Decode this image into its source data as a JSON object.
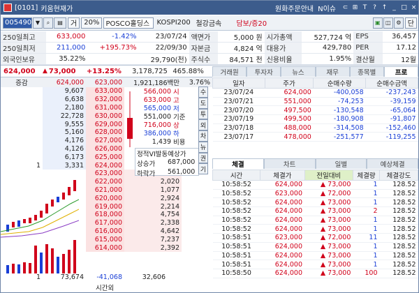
{
  "title": {
    "code": "[0101]",
    "name": "키움현재가",
    "right_label": "원화주문안내",
    "notice": "N이슈"
  },
  "toolbar": {
    "code": "005490",
    "type": "거",
    "pct": "20%",
    "stock": "POSCO홀딩스",
    "index": "KOSPI200",
    "sector": "철강금속",
    "margin": "담보/증20"
  },
  "info": {
    "rows": [
      {
        "l1": "250일최고",
        "v1": "633,000",
        "c1": "-1.42%",
        "d1": "23/07/24",
        "l2": "액면가",
        "v2": "5,000 원",
        "l3": "시가총액",
        "v3": "527,724 억",
        "l4": "EPS",
        "v4": "36,457"
      },
      {
        "l1": "250일최저",
        "v1": "211,000",
        "c1": "+195.73%",
        "d1": "22/09/30",
        "l2": "자본금",
        "v2": "4,824 억",
        "l3": "대용가",
        "v3": "429,780",
        "l4": "PER",
        "v4": "17.12"
      },
      {
        "l1": "외국인보유",
        "v1": "35.22%",
        "c1": "",
        "d1": "29,790(천)",
        "l2": "주식수",
        "v2": "84,571 천",
        "l3": "신용비율",
        "v3": "1.95%",
        "l4": "결산월",
        "v4": "12월"
      }
    ]
  },
  "price": {
    "current": "624,000",
    "change": "73,000",
    "rate": "+13.25%",
    "volume": "3,178,725",
    "ratio": "465.88%"
  },
  "orderbook_header": {
    "label": "증감",
    "sell_top": "624,000",
    "buy_top": "623,000",
    "total": "1,921,186백만",
    "pct": "3.76%"
  },
  "sells": [
    {
      "q": "9,607",
      "p": "633,000"
    },
    {
      "q": "6,638",
      "p": "632,000"
    },
    {
      "q": "2,180",
      "p": "631,000"
    },
    {
      "q": "22,728",
      "p": "630,000"
    },
    {
      "q": "9,555",
      "p": "629,000"
    },
    {
      "q": "5,160",
      "p": "628,000"
    },
    {
      "q": "4,176",
      "p": "627,000"
    },
    {
      "q": "4,126",
      "p": "626,000"
    },
    {
      "q": "6,173",
      "p": "625,000"
    },
    {
      "q": "3,331",
      "p": "624,000",
      "ch": "1"
    }
  ],
  "buys": [
    {
      "p": "623,000",
      "q": "3,008"
    },
    {
      "p": "622,000",
      "q": "2,020"
    },
    {
      "p": "621,000",
      "q": "1,077"
    },
    {
      "p": "620,000",
      "q": "2,924"
    },
    {
      "p": "619,000",
      "q": "2,214"
    },
    {
      "p": "618,000",
      "q": "4,754"
    },
    {
      "p": "617,000",
      "q": "2,338"
    },
    {
      "p": "616,000",
      "q": "4,642"
    },
    {
      "p": "615,000",
      "q": "7,237"
    },
    {
      "p": "614,000",
      "q": "2,392"
    }
  ],
  "quote_box": [
    {
      "k": "시",
      "v": "566,000"
    },
    {
      "k": "고",
      "v": "633,000"
    },
    {
      "k": "저",
      "v": "565,000"
    },
    {
      "k": "기준",
      "v": "551,000"
    },
    {
      "k": "상",
      "v": "716,000"
    },
    {
      "k": "하",
      "v": "386,000"
    },
    {
      "k": "비용",
      "v": "1,439"
    }
  ],
  "vi": {
    "title": "정적VI발동예상가",
    "up_label": "상승가",
    "up": "687,000",
    "down_label": "하락가",
    "down": "561,000"
  },
  "side_buttons": [
    "수",
    "도",
    "투",
    "외",
    "차",
    "뉴",
    "권",
    "기"
  ],
  "bottom": {
    "left_ch": "1",
    "sell_total": "73,674",
    "diff": "-41,068",
    "buy_total": "32,606",
    "time_label": "시간외"
  },
  "tabs": [
    "거래원",
    "투자자",
    "뉴스",
    "재무",
    "종목별",
    "프로"
  ],
  "daily": {
    "headers": [
      "일자",
      "주가",
      "순매수량",
      "순매수금액"
    ],
    "rows": [
      [
        "23/07/24",
        "624,000",
        "-400,058",
        "-237,243"
      ],
      [
        "23/07/21",
        "551,000",
        "-74,253",
        "-39,159"
      ],
      [
        "23/07/20",
        "497,500",
        "-130,548",
        "-65,064"
      ],
      [
        "23/07/19",
        "499,500",
        "-180,908",
        "-91,807"
      ],
      [
        "23/07/18",
        "488,000",
        "-314,508",
        "-152,460"
      ],
      [
        "23/07/17",
        "478,000",
        "-251,577",
        "-119,255"
      ]
    ]
  },
  "tabs2": [
    "체결",
    "차트",
    "일별",
    "예상체결"
  ],
  "trades": {
    "headers": [
      "시간",
      "체결가",
      "전일대비",
      "체결량",
      "체결강도"
    ],
    "rows": [
      [
        "10:58:52",
        "624,000",
        "73,000",
        "1",
        "128.52"
      ],
      [
        "10:58:52",
        "623,000",
        "72,000",
        "1",
        "128.52"
      ],
      [
        "10:58:52",
        "624,000",
        "73,000",
        "1",
        "128.52"
      ],
      [
        "10:58:52",
        "624,000",
        "73,000",
        "2",
        "128.52"
      ],
      [
        "10:58:52",
        "624,000",
        "73,000",
        "1",
        "128.52"
      ],
      [
        "10:58:52",
        "624,000",
        "73,000",
        "1",
        "128.52"
      ],
      [
        "10:58:51",
        "623,000",
        "72,000",
        "11",
        "128.52"
      ],
      [
        "10:58:51",
        "624,000",
        "73,000",
        "1",
        "128.52"
      ],
      [
        "10:58:51",
        "624,000",
        "73,000",
        "1",
        "128.52"
      ],
      [
        "10:58:51",
        "624,000",
        "73,000",
        "1",
        "128.52"
      ],
      [
        "10:58:50",
        "624,000",
        "73,000",
        "100",
        "128.52"
      ]
    ]
  }
}
